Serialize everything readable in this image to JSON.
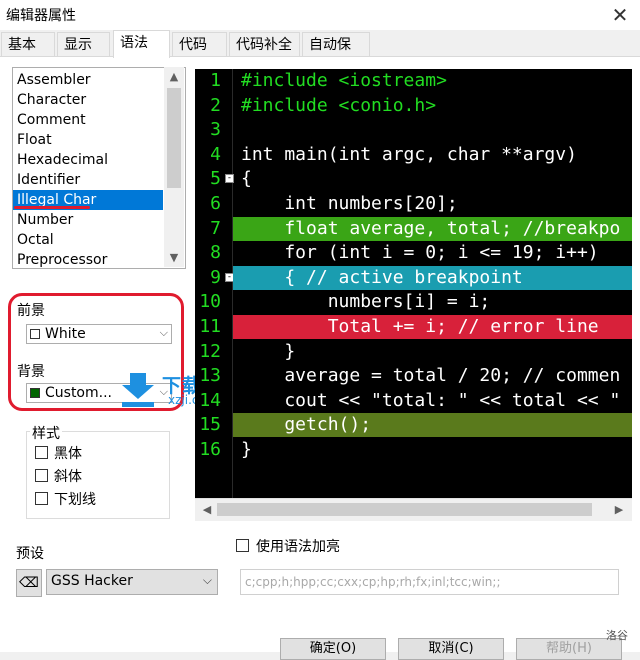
{
  "window": {
    "title": "编辑器属性",
    "close": "✕"
  },
  "tabs": [
    "基本",
    "显示",
    "语法",
    "代码",
    "代码补全",
    "自动保存"
  ],
  "active_tab": 2,
  "syntax_list": {
    "items": [
      "Assembler",
      "Character",
      "Comment",
      "Float",
      "Hexadecimal",
      "Identifier",
      "Illegal Char",
      "Number",
      "Octal",
      "Preprocessor"
    ],
    "selected": "Illegal Char"
  },
  "foreground": {
    "label": "前景",
    "value": "White",
    "swatch": "#ffffff"
  },
  "background": {
    "label": "背景",
    "value": "Custom...",
    "swatch": "#006400"
  },
  "style_group": {
    "title": "样式",
    "options": [
      "黑体",
      "斜体",
      "下划线"
    ]
  },
  "code": {
    "lines": [
      {
        "n": "1",
        "text": "#include <iostream>",
        "color": "#22dd22",
        "bg": "",
        "fold": ""
      },
      {
        "n": "2",
        "text": "#include <conio.h>",
        "color": "#22dd22",
        "bg": "",
        "fold": ""
      },
      {
        "n": "3",
        "text": "",
        "color": "#ffffff",
        "bg": "",
        "fold": ""
      },
      {
        "n": "4",
        "text": "int main(int argc, char **argv)",
        "color": "#ffffff",
        "bg": "",
        "fold": ""
      },
      {
        "n": "5",
        "text": "{",
        "color": "#ffffff",
        "bg": "",
        "fold": "-"
      },
      {
        "n": "6",
        "text": "    int numbers[20];",
        "color": "#ffffff",
        "bg": "",
        "fold": ""
      },
      {
        "n": "7",
        "text": "    float average, total; //breakpo",
        "color": "#ffffff",
        "bg": "#3aa516",
        "fold": ""
      },
      {
        "n": "8",
        "text": "    for (int i = 0; i <= 19; i++)",
        "color": "#ffffff",
        "bg": "",
        "fold": ""
      },
      {
        "n": "9",
        "text": "    { // active breakpoint",
        "color": "#ffffff",
        "bg": "#1a9db0",
        "fold": "-"
      },
      {
        "n": "10",
        "text": "        numbers[i] = i;",
        "color": "#ffffff",
        "bg": "",
        "fold": ""
      },
      {
        "n": "11",
        "text": "        Total += i; // error line",
        "color": "#ffffff",
        "bg": "#d8213a",
        "fold": ""
      },
      {
        "n": "12",
        "text": "    }",
        "color": "#ffffff",
        "bg": "",
        "fold": ""
      },
      {
        "n": "13",
        "text": "    average = total / 20; // commen",
        "color": "#ffffff",
        "bg": "",
        "fold": ""
      },
      {
        "n": "14",
        "text": "    cout << \"total: \" << total << \"",
        "color": "#ffffff",
        "bg": "",
        "fold": ""
      },
      {
        "n": "15",
        "text": "    getch();",
        "color": "#ffffff",
        "bg": "#5a7a1c",
        "fold": ""
      },
      {
        "n": "16",
        "text": "}",
        "color": "#ffffff",
        "bg": "",
        "fold": ""
      }
    ]
  },
  "preset": {
    "label": "预设",
    "value": "GSS Hacker"
  },
  "enhance": {
    "label": "使用语法加亮",
    "checked": false
  },
  "extensions": "c;cpp;h;hpp;cc;cxx;cp;hp;rh;fx;inl;tcc;win;;",
  "buttons": {
    "ok": "确定(O)",
    "cancel": "取消(C)",
    "help": "帮助(H)"
  },
  "watermark": {
    "brand": "下载集",
    "site": "xzji.com"
  },
  "corner_text": "洛谷",
  "colors": {
    "accent": "#0078d7",
    "highlight_red": "#e01b2e"
  }
}
